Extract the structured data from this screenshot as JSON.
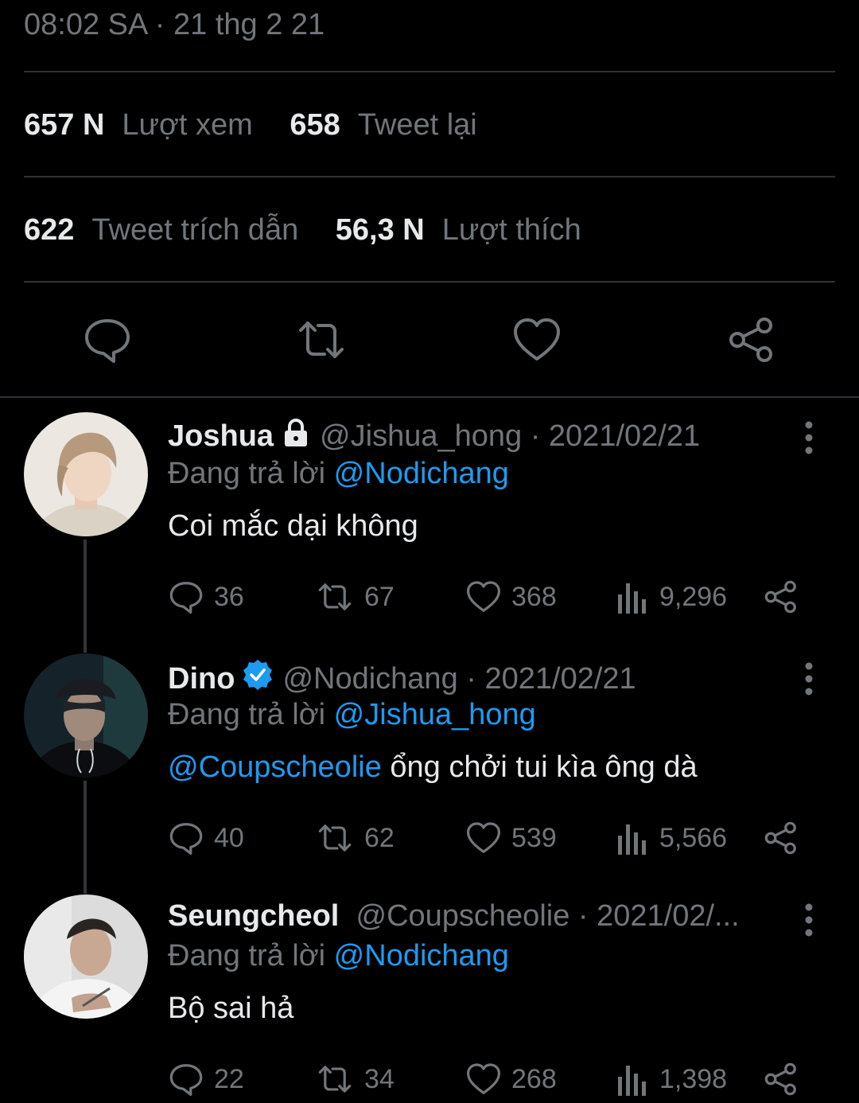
{
  "tweet": {
    "timestamp": "08:02 SA · 21 thg 2 21",
    "stats": {
      "views_count": "657 N",
      "views_label": "Lượt xem",
      "retweets_count": "658",
      "retweets_label": "Tweet lại",
      "quotes_count": "622",
      "quotes_label": "Tweet trích dẫn",
      "likes_count": "56,3 N",
      "likes_label": "Lượt thích"
    },
    "actions": [
      "reply-icon",
      "retweet-icon",
      "like-icon",
      "share-icon"
    ]
  },
  "replies": [
    {
      "name": "Joshua",
      "badge": "lock-icon",
      "handle": "@Jishua_hong",
      "date": "· 2021/02/21",
      "replying_prefix": "Đang trả lời",
      "replying_to": "@Nodichang",
      "text": "Coi mắc dại không",
      "mention": "",
      "reply_count": "36",
      "retweet_count": "67",
      "like_count": "368",
      "view_count": "9,296"
    },
    {
      "name": "Dino",
      "badge": "verified-icon",
      "handle": "@Nodichang",
      "date": "· 2021/02/21",
      "replying_prefix": "Đang trả lời",
      "replying_to": "@Jishua_hong",
      "mention": "@Coupscheolie",
      "text": " ổng chởi tui kìa ông dà",
      "reply_count": "40",
      "retweet_count": "62",
      "like_count": "539",
      "view_count": "5,566"
    },
    {
      "name": "Seungcheol",
      "badge": "",
      "handle": "@Coupscheolie",
      "date": "· 2021/02/...",
      "replying_prefix": "Đang trả lời",
      "replying_to": "@Nodichang",
      "text": "Bộ sai hả",
      "mention": "",
      "reply_count": "22",
      "retweet_count": "34",
      "like_count": "268",
      "view_count": "1,398"
    }
  ],
  "colors": {
    "background": "#000000",
    "primary_text": "#e7e9ea",
    "secondary_text": "#71767b",
    "accent": "#1d9bf0",
    "divider": "#2f3336"
  }
}
